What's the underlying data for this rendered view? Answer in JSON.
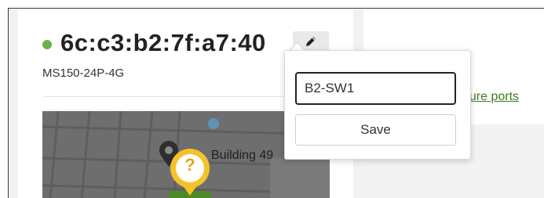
{
  "device": {
    "title": "6c:c3:b2:7f:a7:40",
    "model": "MS150-24P-4G",
    "status_color": "#67b346"
  },
  "map": {
    "label": "Building 49",
    "marker_symbol": "?"
  },
  "link": {
    "configure_text": "gure ports"
  },
  "rename_popover": {
    "input_value": "B2-SW1",
    "save_label": "Save"
  },
  "icons": {
    "edit": "pencil-icon",
    "marker": "map-marker-icon",
    "pin": "location-pin-icon"
  }
}
